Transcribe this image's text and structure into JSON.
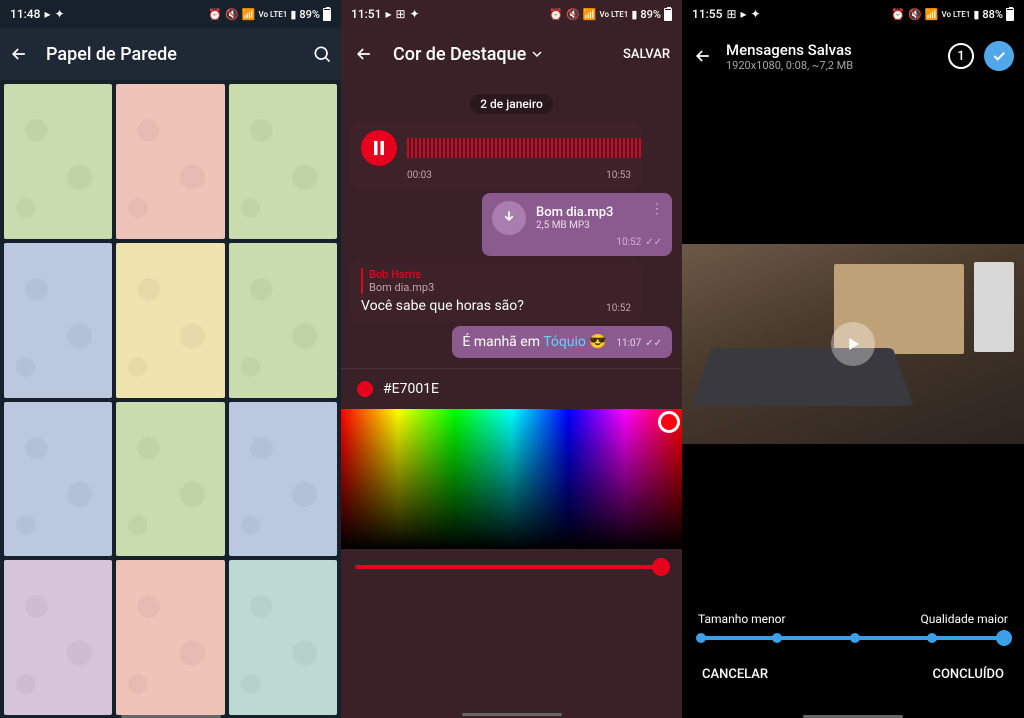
{
  "screens": {
    "s1": {
      "status": {
        "time": "11:48",
        "battery": "89%",
        "net": "Vo LTE1"
      },
      "header": {
        "title": "Papel de Parede"
      },
      "tiles": [
        "#c8dcad",
        "#eec3b8",
        "#c8dcad",
        "#bac9e0",
        "#efe3b0",
        "#c8dcad",
        "#bac9e0",
        "#c8dcad",
        "#bac9e0",
        "#d6c4d9",
        "#eec3b8",
        "#bdd9d4"
      ]
    },
    "s2": {
      "status": {
        "time": "11:51",
        "battery": "89%",
        "net": "Vo LTE1"
      },
      "header": {
        "title": "Cor de Destaque",
        "save": "SALVAR"
      },
      "chat": {
        "date": "2 de janeiro",
        "voice": {
          "elapsed": "00:03",
          "time": "10:53"
        },
        "file": {
          "name": "Bom dia.mp3",
          "size": "2,5 MB MP3",
          "time": "10:52"
        },
        "reply": {
          "name": "Bob Harris",
          "text": "Bom dia.mp3"
        },
        "incoming": {
          "text": "Você sabe que horas são?",
          "time": "10:52"
        },
        "outgoing": {
          "text": "É manhã em ",
          "link": "Tóquio",
          "emoji": "😎",
          "time": "11:07"
        }
      },
      "hex": "#E7001E"
    },
    "s3": {
      "status": {
        "time": "11:55",
        "battery": "88%",
        "net": "Vo LTE1"
      },
      "header": {
        "title": "Mensagens Salvas",
        "subtitle": "1920x1080, 0:08, ~7,2 MB",
        "count": "1"
      },
      "quality": {
        "left_label": "Tamanho menor",
        "right_label": "Qualidade maior"
      },
      "footer": {
        "cancel": "CANCELAR",
        "done": "CONCLUÍDO"
      }
    }
  }
}
